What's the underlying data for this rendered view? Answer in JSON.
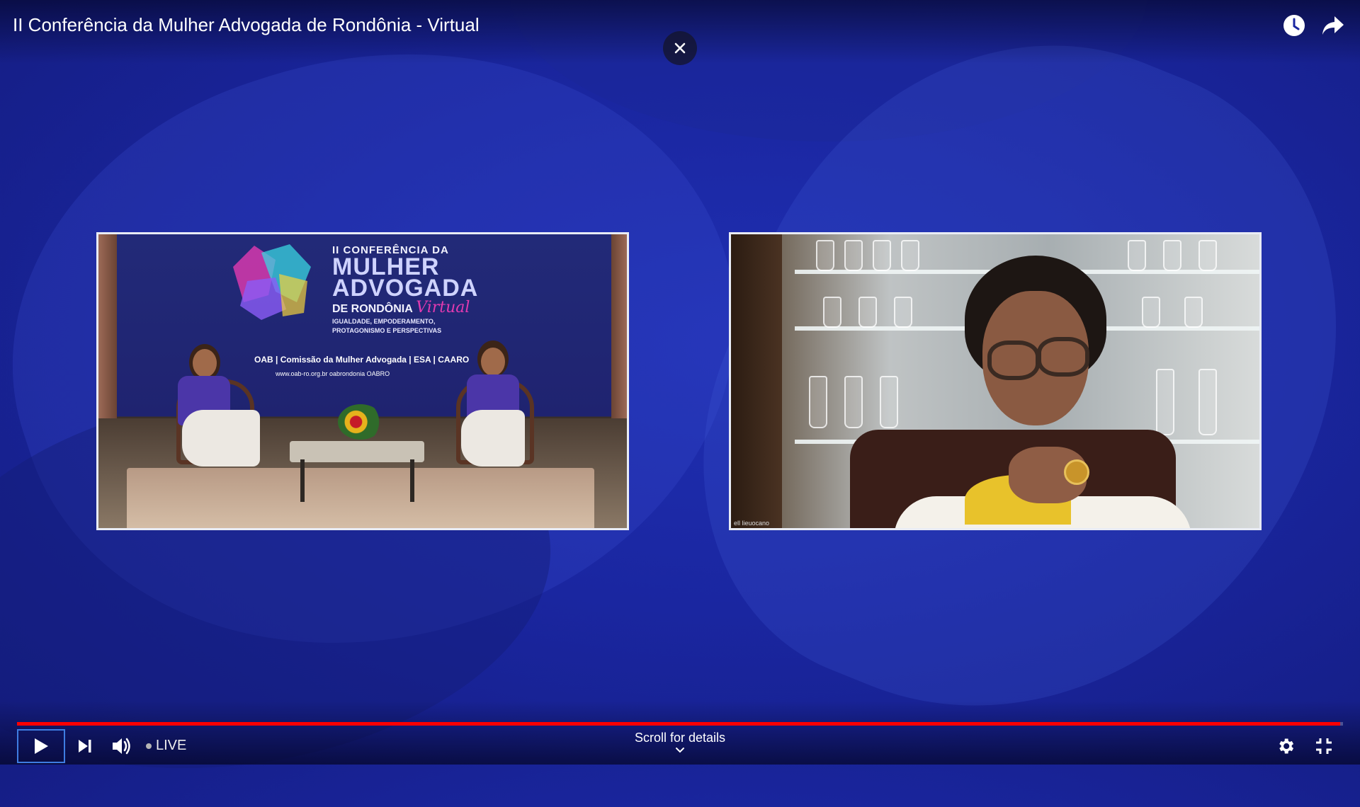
{
  "header": {
    "title": "II Conferência da Mulher Advogada de Rondônia - Virtual",
    "icons": [
      "watch-later-icon",
      "share-icon"
    ],
    "close_icon": "close-icon"
  },
  "left_video": {
    "banner": {
      "line1": "II CONFERÊNCIA DA",
      "line2": "MULHER",
      "line3": "ADVOGADA",
      "line4": "DE RONDÔNIA",
      "virtual": "Virtual",
      "subtitle1": "IGUALDADE, EMPODERAMENTO,",
      "subtitle2": "PROTAGONISMO E PERSPECTIVAS"
    },
    "logos": "OAB | Comissão da Mulher Advogada | ESA | CAARO",
    "links": "www.oab-ro.org.br   oabrondonia   OABRO"
  },
  "right_video": {
    "name_tag": "ell lieuocano"
  },
  "player": {
    "progress_fraction": 0.998,
    "live_label": "LIVE",
    "scroll_label": "Scroll for details",
    "accent_color": "#ff0000",
    "icons": [
      "play-icon",
      "next-icon",
      "volume-icon",
      "settings-icon",
      "exit-fullscreen-icon"
    ]
  }
}
